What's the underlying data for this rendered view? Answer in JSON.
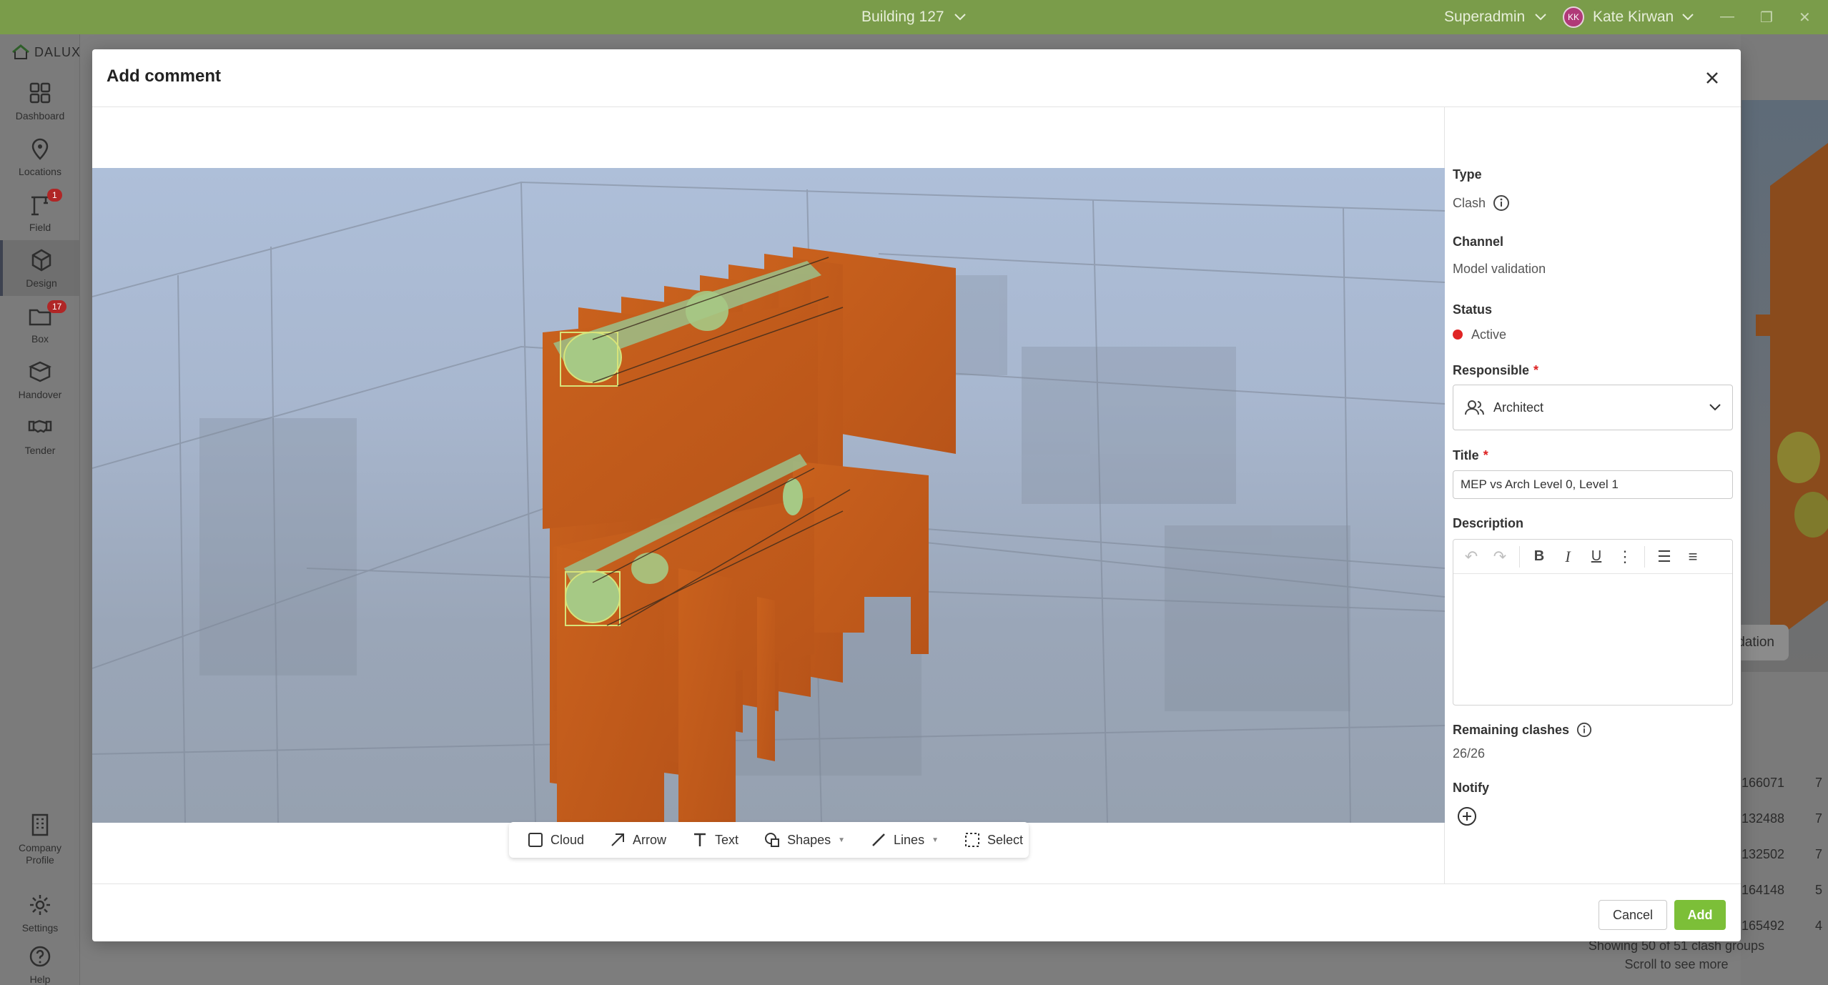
{
  "topbar": {
    "project": "Building 127",
    "role": "Superadmin",
    "user_initials": "KK",
    "user_name": "Kate Kirwan"
  },
  "sidebar": {
    "logo": "DALUX",
    "items": [
      {
        "label": "Dashboard",
        "icon": "grid-icon"
      },
      {
        "label": "Locations",
        "icon": "pin-icon"
      },
      {
        "label": "Field",
        "icon": "crane-icon",
        "badge": "1"
      },
      {
        "label": "Design",
        "icon": "cube-icon"
      },
      {
        "label": "Box",
        "icon": "folder-icon",
        "badge": "17"
      },
      {
        "label": "Handover",
        "icon": "box-icon"
      },
      {
        "label": "Tender",
        "icon": "handshake-icon"
      },
      {
        "label": "Company Profile",
        "icon": "building-icon"
      },
      {
        "label": "Settings",
        "icon": "gear-icon"
      },
      {
        "label": "Help",
        "icon": "help-icon"
      }
    ]
  },
  "background": {
    "chip_label": "dation",
    "rows": [
      {
        "id": "166071",
        "count": "7"
      },
      {
        "id": "132488",
        "count": "7"
      },
      {
        "id": "132502",
        "count": "7"
      },
      {
        "id": "164148",
        "count": "5"
      },
      {
        "id": "165492",
        "count": "4"
      }
    ],
    "footer_line1": "Showing 50 of 51 clash groups",
    "footer_line2": "Scroll to see more"
  },
  "modal": {
    "title": "Add comment",
    "toolbar": {
      "cloud": "Cloud",
      "arrow": "Arrow",
      "text": "Text",
      "shapes": "Shapes",
      "lines": "Lines",
      "select": "Select"
    },
    "panel": {
      "type_label": "Type",
      "type_value": "Clash",
      "channel_label": "Channel",
      "channel_value": "Model validation",
      "status_label": "Status",
      "status_value": "Active",
      "responsible_label": "Responsible",
      "responsible_value": "Architect",
      "title_label": "Title",
      "title_value": "MEP vs Arch Level 0, Level 1",
      "description_label": "Description",
      "remaining_label": "Remaining clashes",
      "remaining_value": "26/26",
      "notify_label": "Notify"
    },
    "cancel_label": "Cancel",
    "add_label": "Add"
  },
  "colors": {
    "topbar": "#7a9c4a",
    "accent_green": "#7cbf38",
    "status_active": "#e02525",
    "clash_orange": "#c85a1c"
  }
}
